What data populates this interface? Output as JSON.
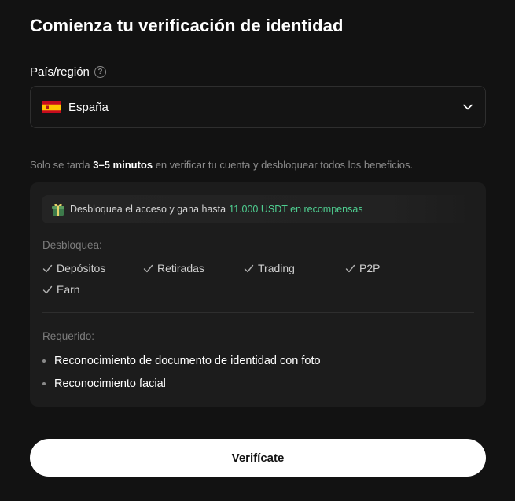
{
  "header": {
    "title": "Comienza tu verificación de identidad"
  },
  "country_field": {
    "label": "País/región",
    "help_icon": "question-circle-icon",
    "selected_value": "España",
    "flag_icon": "spain-flag-icon",
    "flag_colors": {
      "red": "#c60b1e",
      "yellow": "#ffc400"
    }
  },
  "note": {
    "before": "Solo se tarda ",
    "bold": "3–5 minutos",
    "after": " en verificar tu cuenta y desbloquear todos los beneficios."
  },
  "card": {
    "promo": {
      "icon": "gift-box-icon",
      "text": "Desbloquea el acceso y gana hasta",
      "accent": "11.000 USDT en recompensas",
      "accent_color": "#4fcf91"
    },
    "unlock_label": "Desbloquea:",
    "features": [
      "Depósitos",
      "Retiradas",
      "Trading",
      "P2P",
      "Earn"
    ],
    "required_label": "Requerido:",
    "requirements": [
      "Reconocimiento de documento de identidad con foto",
      "Reconocimiento facial"
    ]
  },
  "cta": {
    "label": "Verifícate"
  }
}
